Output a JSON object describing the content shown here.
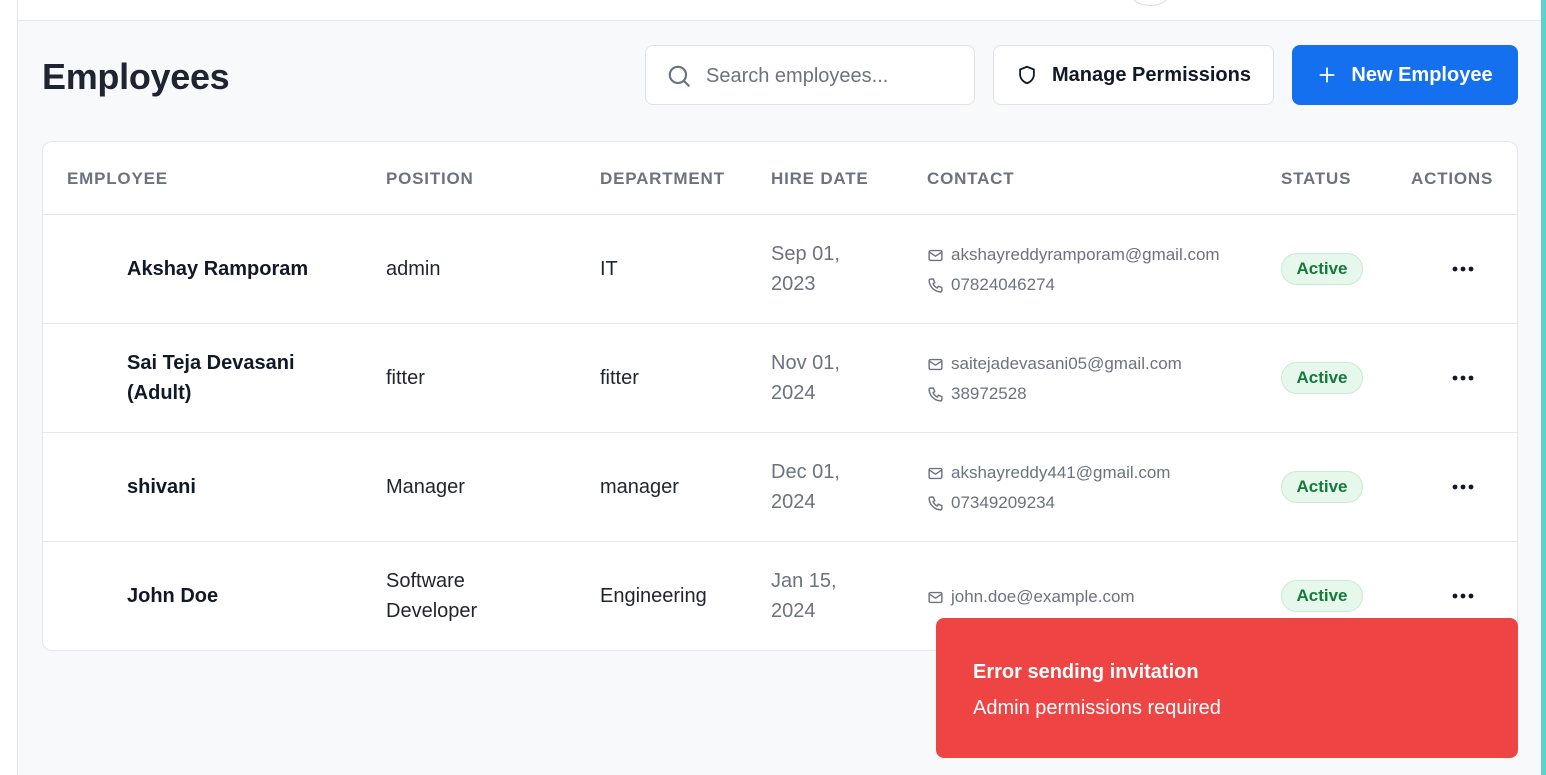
{
  "page": {
    "title": "Employees"
  },
  "search": {
    "placeholder": "Search employees..."
  },
  "toolbar": {
    "manage_permissions_label": "Manage Permissions",
    "new_employee_label": "New Employee"
  },
  "table": {
    "columns": [
      "EMPLOYEE",
      "POSITION",
      "DEPARTMENT",
      "HIRE DATE",
      "CONTACT",
      "STATUS",
      "ACTIONS"
    ],
    "rows": [
      {
        "name_line1": "Akshay Ramporam",
        "name_line2": "",
        "position_line1": "admin",
        "position_line2": "",
        "department": "IT",
        "hire_date_line1": "Sep 01,",
        "hire_date_line2": "2023",
        "email": "akshayreddyramporam@gmail.com",
        "phone": "07824046274",
        "status": "Active"
      },
      {
        "name_line1": "Sai Teja Devasani",
        "name_line2": "(Adult)",
        "position_line1": "fitter",
        "position_line2": "",
        "department": "fitter",
        "hire_date_line1": "Nov 01,",
        "hire_date_line2": "2024",
        "email": "saitejadevasani05@gmail.com",
        "phone": "38972528",
        "status": "Active"
      },
      {
        "name_line1": "shivani",
        "name_line2": "",
        "position_line1": "Manager",
        "position_line2": "",
        "department": "manager",
        "hire_date_line1": "Dec 01,",
        "hire_date_line2": "2024",
        "email": "akshayreddy441@gmail.com",
        "phone": "07349209234",
        "status": "Active"
      },
      {
        "name_line1": "John Doe",
        "name_line2": "",
        "position_line1": "Software",
        "position_line2": "Developer",
        "department": "Engineering",
        "hire_date_line1": "Jan 15,",
        "hire_date_line2": "2024",
        "email": "john.doe@example.com",
        "phone": "",
        "status": "Active"
      }
    ]
  },
  "toast": {
    "title": "Error sending invitation",
    "message": "Admin permissions required"
  },
  "colors": {
    "primary": "#1570ef",
    "error": "#ef4444",
    "status_active_bg": "#e6f7ec",
    "status_active_text": "#137a3c",
    "accent_edge": "#5fd0cf"
  },
  "icons": {
    "search": "search-icon",
    "permissions": "shield-icon",
    "new": "plus-icon",
    "email": "mail-icon",
    "phone": "phone-icon",
    "row_actions": "more-horizontal-icon"
  }
}
